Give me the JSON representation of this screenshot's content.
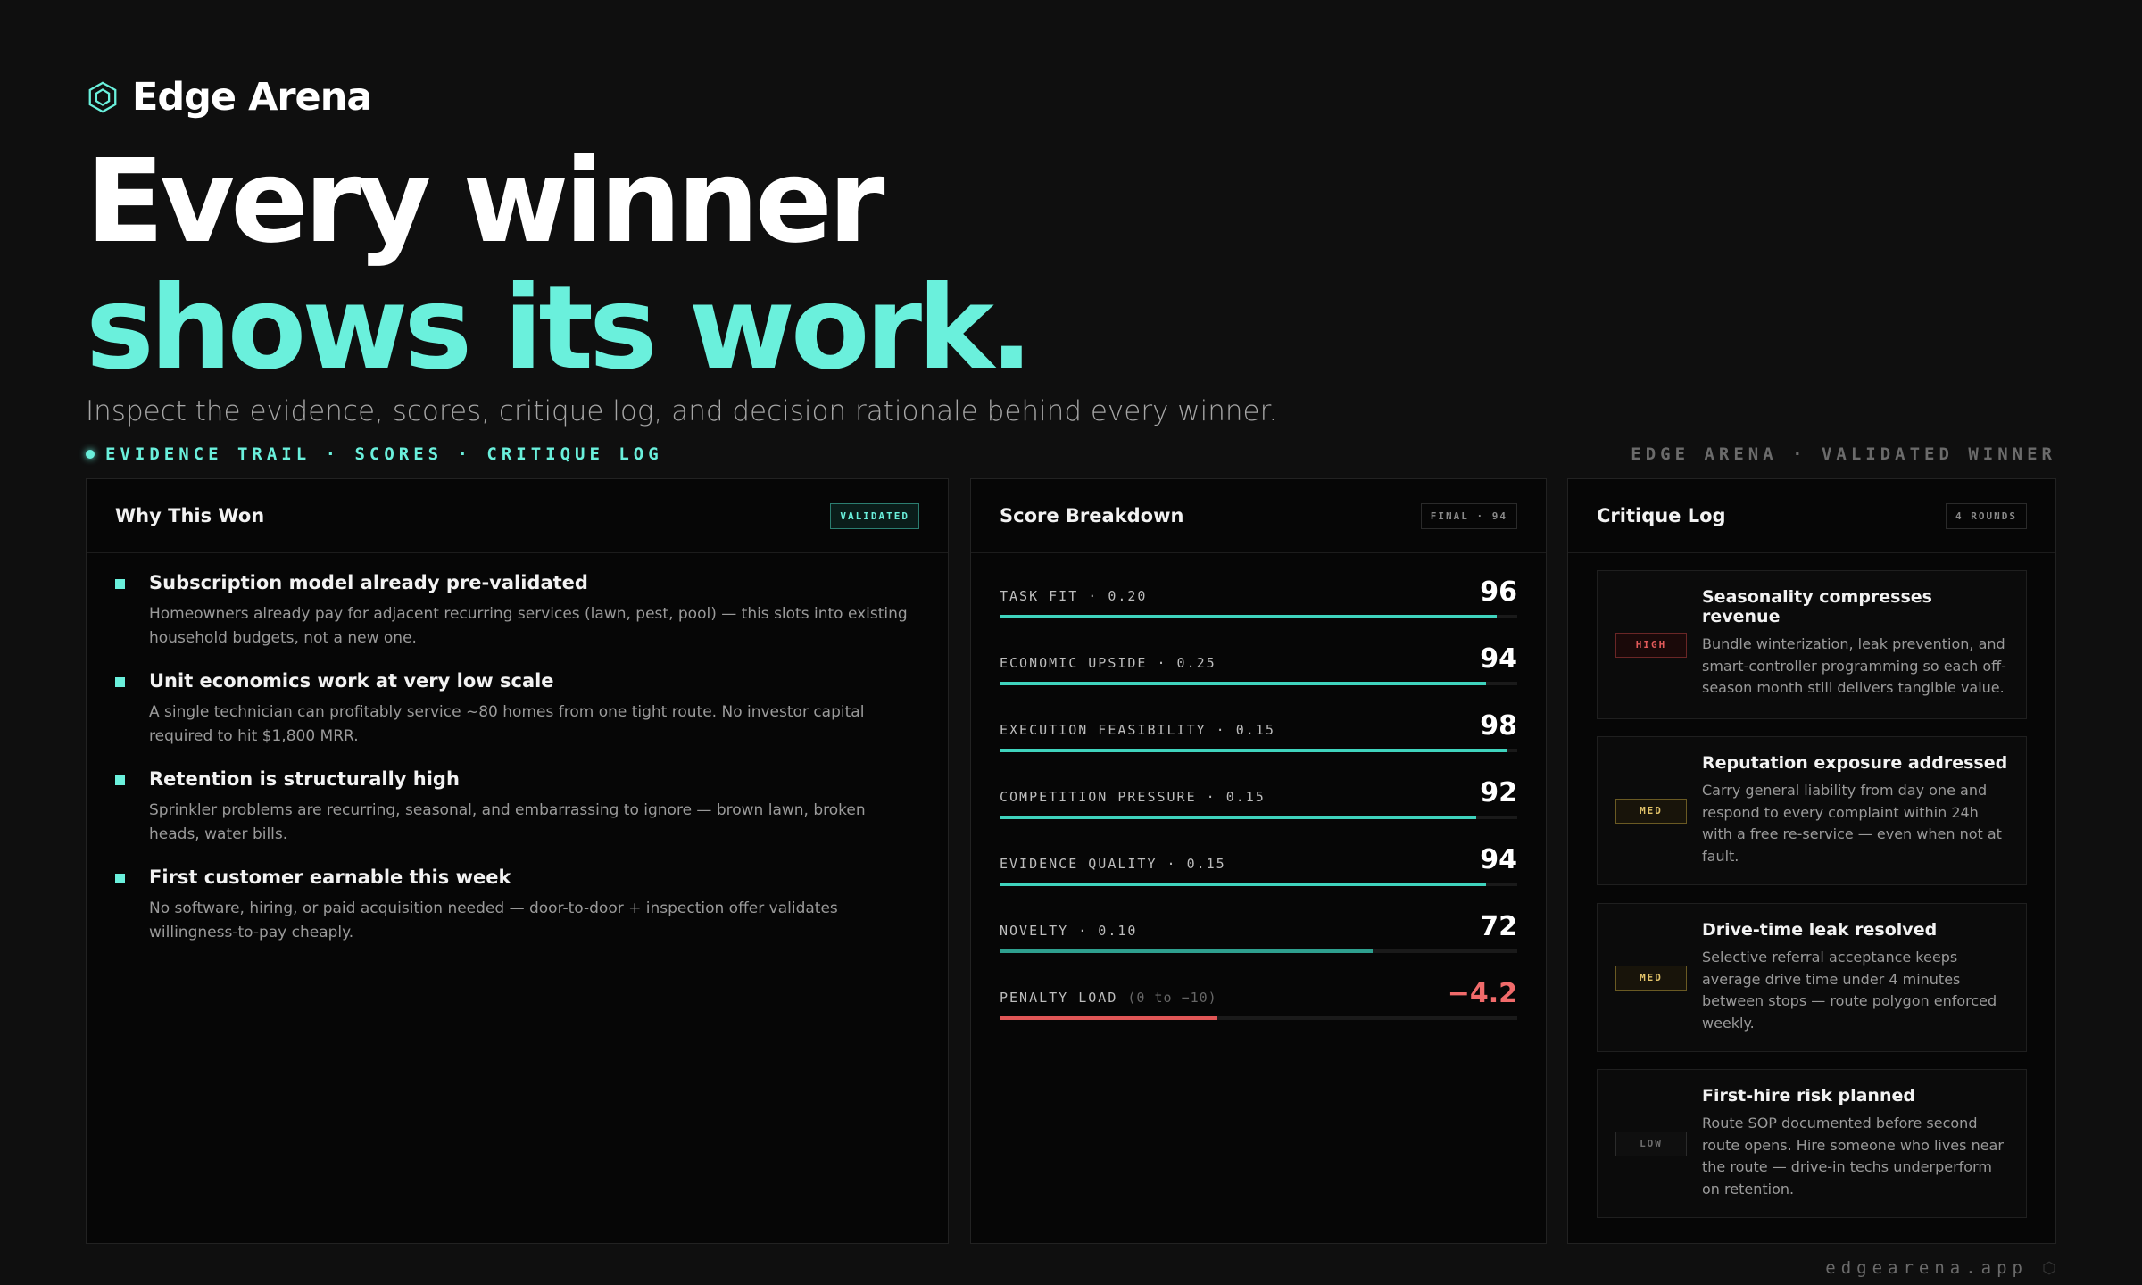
{
  "brand": {
    "name": "Edge Arena"
  },
  "hero": {
    "line1": "Every winner",
    "line2": "shows its work.",
    "subtitle": "Inspect the evidence, scores, critique log, and decision rationale behind every winner."
  },
  "kicker": {
    "left": "EVIDENCE TRAIL · SCORES · CRITIQUE LOG",
    "right": "EDGE ARENA · VALIDATED WINNER"
  },
  "why": {
    "title": "Why This Won",
    "badge": "VALIDATED",
    "items": [
      {
        "title": "Subscription model already pre-validated",
        "desc": "Homeowners already pay for adjacent recurring services (lawn, pest, pool) — this slots into existing household budgets, not a new one."
      },
      {
        "title": "Unit economics work at very low scale",
        "desc": "A single technician can profitably service ~80 homes from one tight route. No investor capital required to hit $1,800 MRR."
      },
      {
        "title": "Retention is structurally high",
        "desc": "Sprinkler problems are recurring, seasonal, and embarrassing to ignore — brown lawn, broken heads, water bills."
      },
      {
        "title": "First customer earnable this week",
        "desc": "No software, hiring, or paid acquisition needed — door-to-door + inspection offer validates willingness-to-pay cheaply."
      }
    ]
  },
  "scores": {
    "title": "Score Breakdown",
    "badge": "FINAL · 94",
    "items": [
      {
        "label": "TASK FIT · 0.20",
        "value": "96",
        "fill": 0.96
      },
      {
        "label": "ECONOMIC UPSIDE · 0.25",
        "value": "94",
        "fill": 0.94
      },
      {
        "label": "EXECUTION FEASIBILITY · 0.15",
        "value": "98",
        "fill": 0.98
      },
      {
        "label": "COMPETITION PRESSURE · 0.15",
        "value": "92",
        "fill": 0.92
      },
      {
        "label": "EVIDENCE QUALITY · 0.15",
        "value": "94",
        "fill": 0.94
      },
      {
        "label": "NOVELTY · 0.10",
        "value": "72",
        "fill": 0.72
      }
    ],
    "penalty": {
      "label": "PENALTY LOAD",
      "sub": "(0 to −10)",
      "value": "−4.2",
      "fill": 0.42
    }
  },
  "critique": {
    "title": "Critique Log",
    "badge": "4 ROUNDS",
    "items": [
      {
        "tag": "HIGH",
        "title": "Seasonality compresses revenue",
        "desc": "Bundle winterization, leak prevention, and smart-controller programming so each off-season month still delivers tangible value."
      },
      {
        "tag": "MED",
        "title": "Reputation exposure addressed",
        "desc": "Carry general liability from day one and respond to every complaint within 24h with a free re-service — even when not at fault."
      },
      {
        "tag": "MED",
        "title": "Drive-time leak resolved",
        "desc": "Selective referral acceptance keeps average drive time under 4 minutes between stops — route polygon enforced weekly."
      },
      {
        "tag": "LOW",
        "title": "First-hire risk planned",
        "desc": "Route SOP documented before second route opens. Hire someone who lives near the route — drive-in techs underperform on retention."
      }
    ]
  },
  "footer": {
    "url": "edgearena.app"
  },
  "colors": {
    "accent": "#6af0dc",
    "danger": "#e25a5a",
    "warning": "#e3c46a",
    "background": "#0f0f0f"
  }
}
